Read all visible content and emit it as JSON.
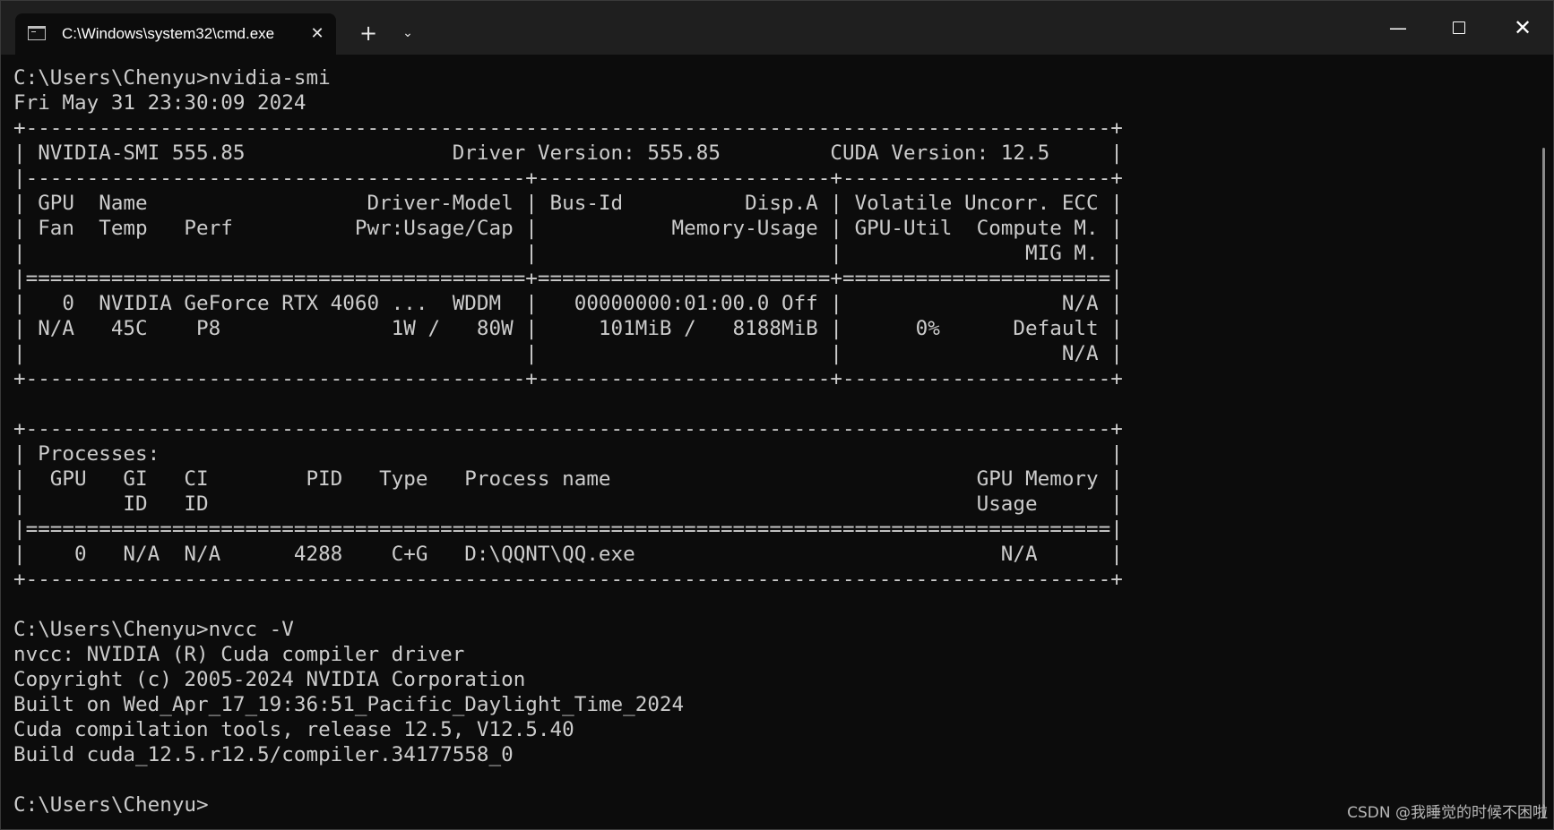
{
  "window": {
    "tab_title": "C:\\Windows\\system32\\cmd.exe",
    "tab_icon": "cmd-icon",
    "close_tab_glyph": "✕",
    "new_tab_glyph": "+",
    "dropdown_glyph": "⌄",
    "minimize_glyph": "—",
    "close_glyph": "✕"
  },
  "terminal": {
    "lines": [
      "C:\\Users\\Chenyu>nvidia-smi",
      "Fri May 31 23:30:09 2024",
      "+-----------------------------------------------------------------------------------------+",
      "| NVIDIA-SMI 555.85                 Driver Version: 555.85         CUDA Version: 12.5     |",
      "|-----------------------------------------+------------------------+----------------------+",
      "| GPU  Name                  Driver-Model | Bus-Id          Disp.A | Volatile Uncorr. ECC |",
      "| Fan  Temp   Perf          Pwr:Usage/Cap |           Memory-Usage | GPU-Util  Compute M. |",
      "|                                         |                        |               MIG M. |",
      "|=========================================+========================+======================|",
      "|   0  NVIDIA GeForce RTX 4060 ...  WDDM  |   00000000:01:00.0 Off |                  N/A |",
      "| N/A   45C    P8              1W /   80W |     101MiB /   8188MiB |      0%      Default |",
      "|                                         |                        |                  N/A |",
      "+-----------------------------------------+------------------------+----------------------+",
      "",
      "+-----------------------------------------------------------------------------------------+",
      "| Processes:                                                                              |",
      "|  GPU   GI   CI        PID   Type   Process name                              GPU Memory |",
      "|        ID   ID                                                               Usage      |",
      "|=========================================================================================|",
      "|    0   N/A  N/A      4288    C+G   D:\\QQNT\\QQ.exe                              N/A      |",
      "+-----------------------------------------------------------------------------------------+",
      "",
      "C:\\Users\\Chenyu>nvcc -V",
      "nvcc: NVIDIA (R) Cuda compiler driver",
      "Copyright (c) 2005-2024 NVIDIA Corporation",
      "Built on Wed_Apr_17_19:36:51_Pacific_Daylight_Time_2024",
      "Cuda compilation tools, release 12.5, V12.5.40",
      "Build cuda_12.5.r12.5/compiler.34177558_0",
      "",
      "C:\\Users\\Chenyu>"
    ]
  },
  "watermark": "CSDN @我睡觉的时候不困啦",
  "colors": {
    "terminal_bg": "#0c0c0c",
    "terminal_fg": "#cccccc",
    "titlebar_bg": "#1f1f1f"
  }
}
